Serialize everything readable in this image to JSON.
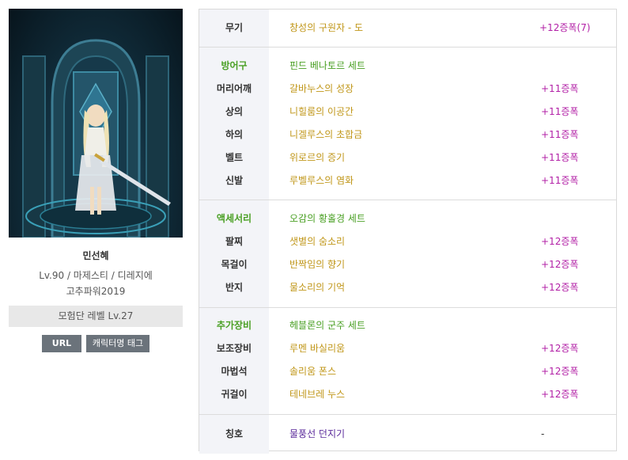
{
  "profile": {
    "name": "민선혜",
    "info_line": "Lv.90 / 마제스티 / 디레지에",
    "guild": "고추파워2019",
    "adventure": "모험단 레벨 Lv.27",
    "url_btn": "URL",
    "tag_btn": "캐릭터명 태그"
  },
  "weapon": {
    "label": "무기",
    "name": "창성의 구원자 - 도",
    "refine": "+12증폭(7)"
  },
  "armor": {
    "header": "방어구",
    "set": "핀드 베나토르 세트",
    "items": [
      {
        "label": "머리어깨",
        "name": "갈바누스의 성장",
        "refine": "+11증폭"
      },
      {
        "label": "상의",
        "name": "니힐룸의 이공간",
        "refine": "+11증폭"
      },
      {
        "label": "하의",
        "name": "니겔루스의 초합금",
        "refine": "+11증폭"
      },
      {
        "label": "벨트",
        "name": "위로르의 증기",
        "refine": "+11증폭"
      },
      {
        "label": "신발",
        "name": "루벨루스의 염화",
        "refine": "+11증폭"
      }
    ]
  },
  "accessory": {
    "header": "액세서리",
    "set": "오감의 황홀경 세트",
    "items": [
      {
        "label": "팔찌",
        "name": "샛별의 숨소리",
        "refine": "+12증폭"
      },
      {
        "label": "목걸이",
        "name": "반짝임의 향기",
        "refine": "+12증폭"
      },
      {
        "label": "반지",
        "name": "물소리의 기억",
        "refine": "+12증폭"
      }
    ]
  },
  "extra": {
    "header": "추가장비",
    "set": "헤블론의 군주 세트",
    "items": [
      {
        "label": "보조장비",
        "name": "루멘 바실리움",
        "refine": "+12증폭"
      },
      {
        "label": "마법석",
        "name": "솔리움 폰스",
        "refine": "+12증폭"
      },
      {
        "label": "귀걸이",
        "name": "테네브레 누스",
        "refine": "+12증폭"
      }
    ]
  },
  "title": {
    "label": "칭호",
    "name": "물풍선 던지기",
    "refine": "-"
  },
  "colors": {
    "item_gold": "#c09618",
    "set_green": "#4aa024",
    "refine_magenta": "#b21fa6",
    "title_purple": "#5b2b9b",
    "label_bg": "#f3f4f8"
  }
}
